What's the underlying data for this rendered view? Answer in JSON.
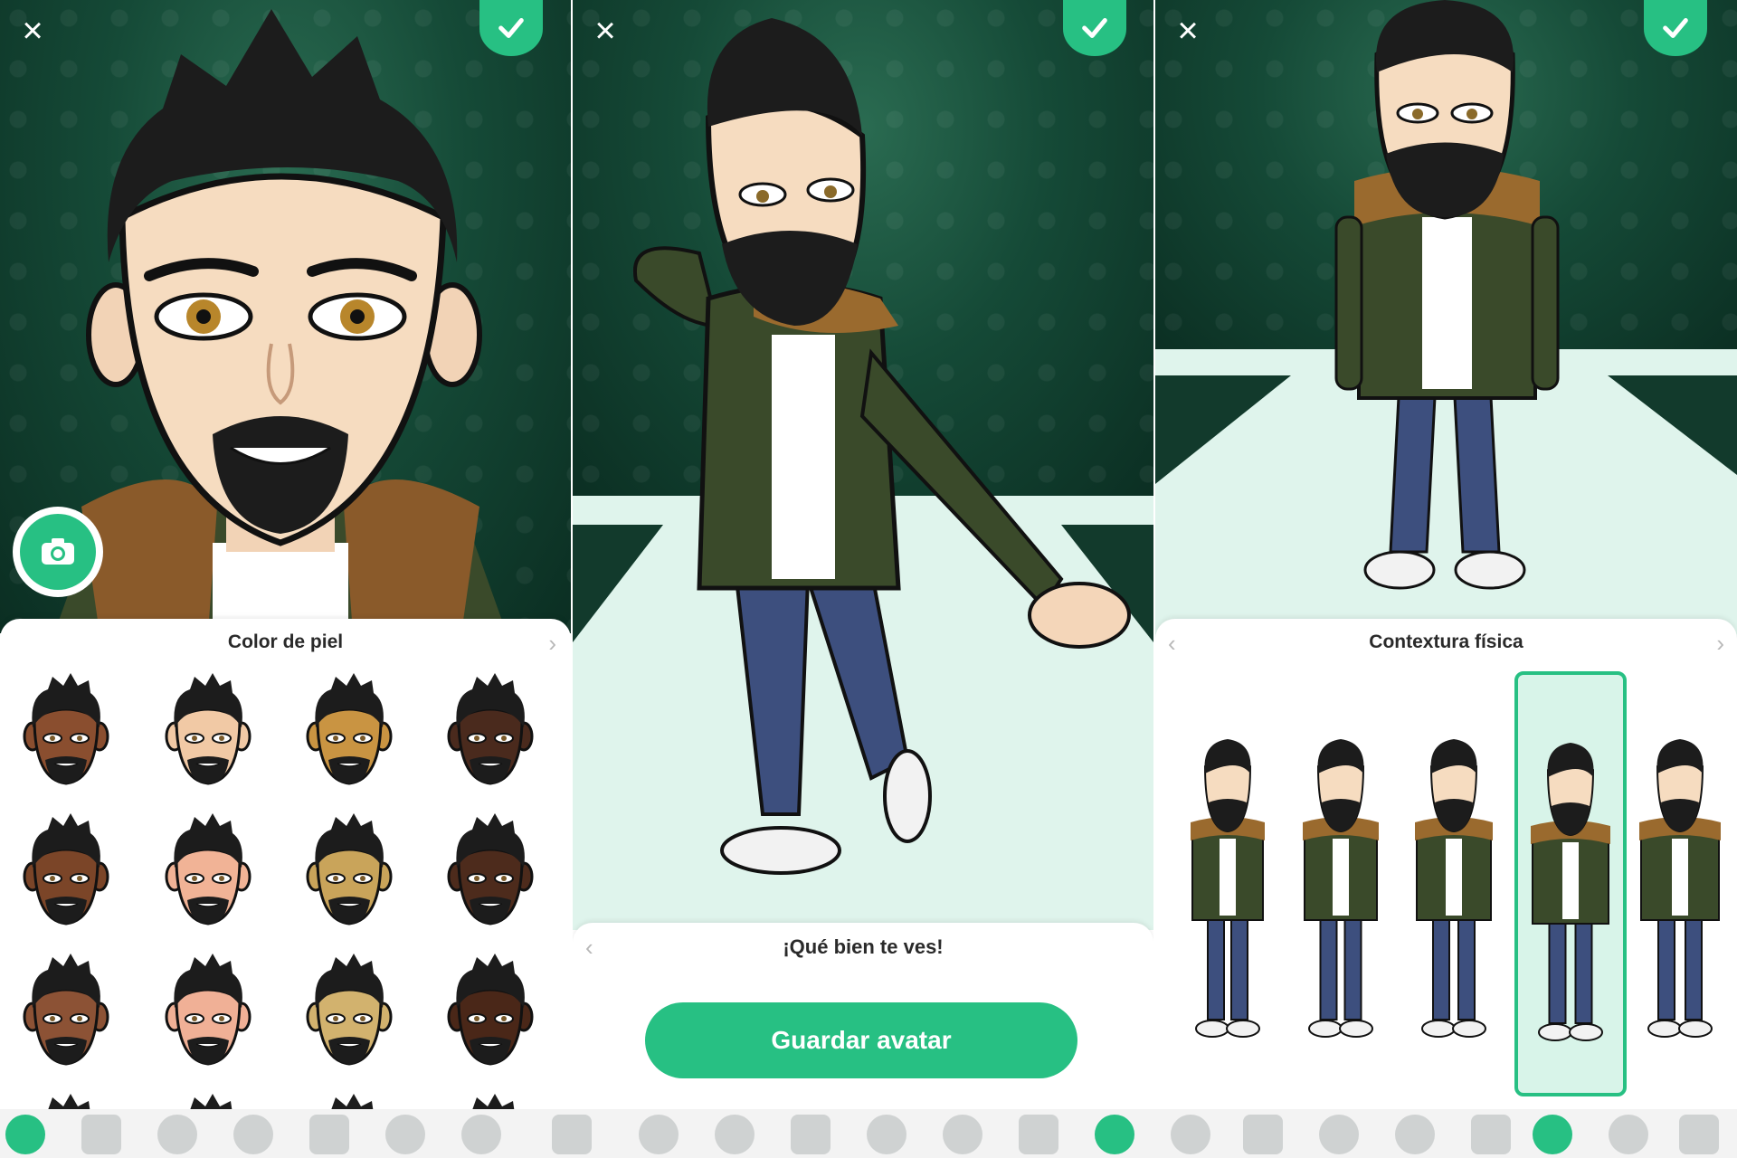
{
  "colors": {
    "accent": "#27c083",
    "stage_dark": "#0b2e22",
    "stage_light": "#2a6b51",
    "floor": "#dff4ec"
  },
  "panel1": {
    "close_icon": "close-icon",
    "confirm_icon": "checkmark-icon",
    "camera_icon": "camera-icon",
    "sheet_title": "Color de piel",
    "skin_tones": [
      "#8a4e2f",
      "#f1c9a5",
      "#c99442",
      "#4a2a1d",
      "#7b4528",
      "#f1b396",
      "#c9a45a",
      "#4d2b1c",
      "#8c5235",
      "#f0b096",
      "#d2b26e",
      "#4a2718"
    ]
  },
  "panel2": {
    "close_icon": "close-icon",
    "confirm_icon": "checkmark-icon",
    "message": "¡Qué bien te ves!",
    "save_label": "Guardar avatar"
  },
  "panel3": {
    "close_icon": "close-icon",
    "confirm_icon": "checkmark-icon",
    "sheet_title": "Contextura física",
    "body_types": [
      "body-type-1",
      "body-type-2",
      "body-type-3",
      "body-type-4",
      "body-type-5"
    ],
    "selected_body_type": 4
  },
  "toolbar": {
    "icons": [
      "skin-icon",
      "hair-icon",
      "facial-hair-icon",
      "eye-icon",
      "eyebrow-icon",
      "nose-icon",
      "glasses-icon",
      "head-shape-icon",
      "mouth-icon",
      "ear-icon",
      "face-lines-icon",
      "hat-icon",
      "body-icon",
      "outfit-icon",
      "checkmark-icon",
      "hair-icon",
      "mouth-icon",
      "ear-icon",
      "face-lines-icon",
      "hat-icon",
      "body-icon",
      "outfit-icon",
      "checkmark-icon"
    ]
  }
}
